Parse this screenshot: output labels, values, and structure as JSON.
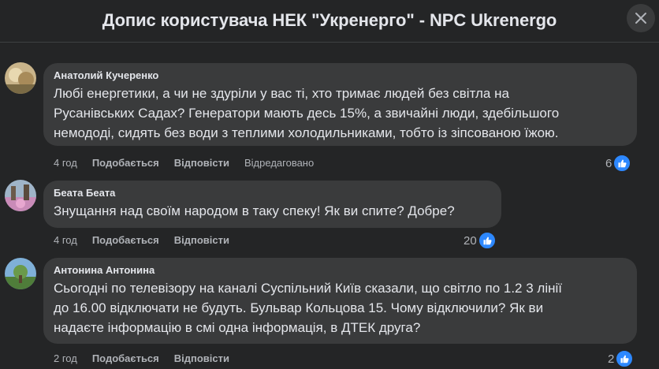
{
  "header": {
    "title": "Допис користувача НЕК \"Укренерго\" - NPC Ukrenergo",
    "close_icon": "close-icon"
  },
  "colors": {
    "background": "#242526",
    "bubble": "#3a3b3c",
    "like_blue": "#2d88ff",
    "secondary_text": "#b0b3b8"
  },
  "comments": [
    {
      "author": "Анатолий Кучеренко",
      "text": "Любі енергетики, а чи не здуріли у вас ті, хто тримає людей без світла на\nРусанівських Садах? Генератори мають десь 15%, а звичайні люди, здебільшого\nнемододі, сидять без води з теплими холодильниками, тобто із зіпсованою їжою.",
      "time": "4 год",
      "like_label": "Подобається",
      "reply_label": "Відповісти",
      "edited_label": "Відредаговано",
      "reaction_count": "6",
      "reaction_icon": "like-icon"
    },
    {
      "author": "Беата Беата",
      "text": "Знущання над своїм народом в таку спеку! Як ви спите? Добре?",
      "time": "4 год",
      "like_label": "Подобається",
      "reply_label": "Відповісти",
      "reaction_count": "20",
      "reaction_icon": "like-icon"
    },
    {
      "author": "Антонина Антонина",
      "text": "Сьогодні по телевізору на каналі Суспільний Київ сказали, що світло по 1.2 3 лінії\nдо 16.00 відключати не будуть. Бульвар Кольцова 15. Чому відключили? Як ви\nнадаєте інформацію в смі одна інформація, в ДТЕК друга?",
      "time": "2 год",
      "like_label": "Подобається",
      "reply_label": "Відповісти",
      "reaction_count": "2",
      "reaction_icon": "like-icon"
    }
  ]
}
